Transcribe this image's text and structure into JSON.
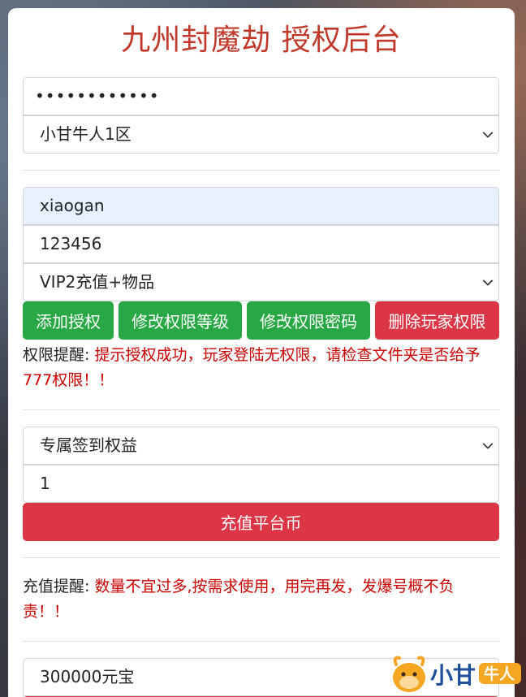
{
  "title": "九州封魔劫 授权后台",
  "login": {
    "password_value": "••••••••••••",
    "server_selected": "小甘牛人1区"
  },
  "player": {
    "account_value": "xiaogan",
    "password_value": "123456",
    "level_selected": "VIP2充值+物品"
  },
  "actions": {
    "add": "添加授权",
    "change_level": "修改权限等级",
    "change_password": "修改权限密码",
    "delete": "删除玩家权限"
  },
  "permission_notice": {
    "label": "权限提醒:",
    "message": " 提示授权成功，玩家登陆无权限，请检查文件夹是否给予777权限！！"
  },
  "recharge": {
    "item_selected": "专属签到权益",
    "quantity_value": "1",
    "submit": "充值平台币"
  },
  "recharge_notice": {
    "label": "充值提醒:",
    "message": " 数量不宜过多,按需求使用，用完再发，发爆号概不负责！！"
  },
  "yuanbao": {
    "amount_selected": "300000元宝"
  },
  "watermark": {
    "text": "小甘",
    "badge": "牛人"
  },
  "colors": {
    "title": "#c0392b",
    "green": "#28a745",
    "red": "#dc3545",
    "warn": "#cc0000"
  }
}
